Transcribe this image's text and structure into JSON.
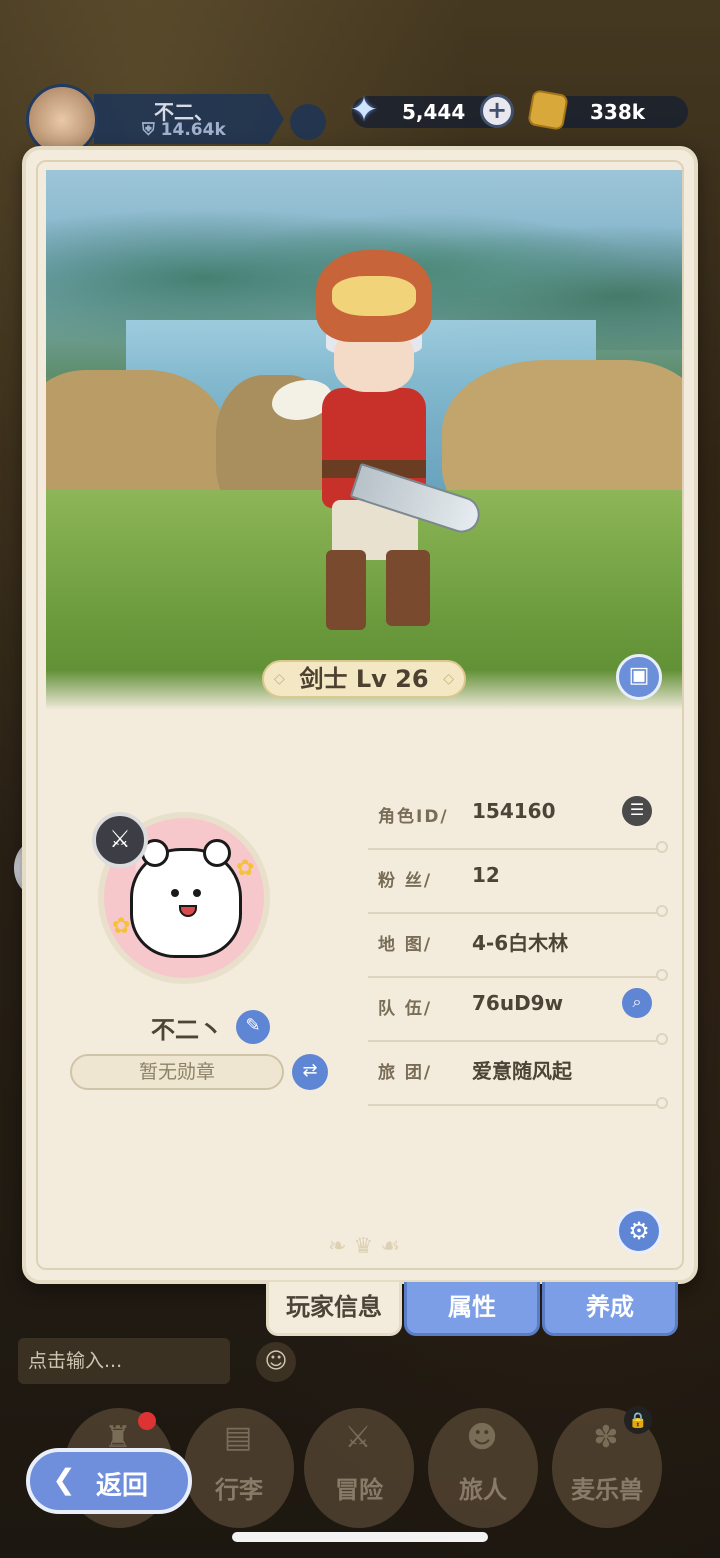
{
  "hud": {
    "player_name": "不二、",
    "power": "14.64k",
    "gems": "5,444",
    "gold": "338k"
  },
  "card": {
    "class_badge": "剑士 Lv 26",
    "player_name": "不二丶",
    "medal_placeholder": "暂无勋章",
    "info": [
      {
        "label": "角色ID/",
        "value": "154160"
      },
      {
        "label": "粉  丝/",
        "value": "12"
      },
      {
        "label": "地  图/",
        "value": "4-6白木林"
      },
      {
        "label": "队  伍/",
        "value": "76uD9w"
      },
      {
        "label": "旅  团/",
        "value": "爱意随风起"
      }
    ]
  },
  "tabs": [
    {
      "label": "玩家信息",
      "active": true
    },
    {
      "label": "属性",
      "active": false
    },
    {
      "label": "养成",
      "active": false
    }
  ],
  "chat": {
    "placeholder": "点击输入..."
  },
  "nav": [
    {
      "label": "",
      "icon": "castle-icon"
    },
    {
      "label": "行李",
      "icon": "bag-icon"
    },
    {
      "label": "冒险",
      "icon": "crossed-swords-icon"
    },
    {
      "label": "旅人",
      "icon": "traveler-icon"
    },
    {
      "label": "麦乐兽",
      "icon": "pet-icon"
    }
  ],
  "back": {
    "label": "返回"
  },
  "colors": {
    "accent": "#6f8fdc",
    "card_bg": "#f3ecdd"
  }
}
